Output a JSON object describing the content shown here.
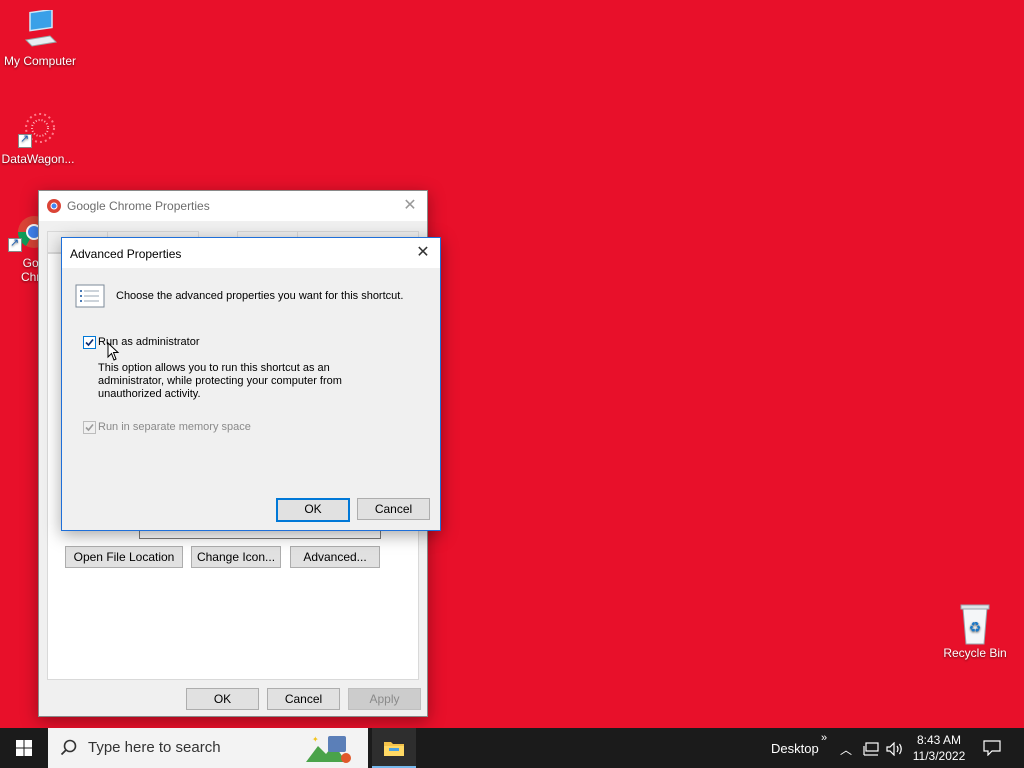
{
  "desktop": {
    "background_color": "#e8102a",
    "icons": [
      {
        "label": "My Computer",
        "icon": "computer-icon"
      },
      {
        "label": "DataWagon...",
        "icon": "datawagon-icon"
      },
      {
        "label": "Goo\nChro",
        "icon": "chrome-icon"
      },
      {
        "label": "Recycle Bin",
        "icon": "recycle-bin-icon"
      }
    ]
  },
  "properties_dialog": {
    "title": "Google Chrome Properties",
    "buttons": {
      "open_file_location": "Open File Location",
      "change_icon": "Change Icon...",
      "advanced": "Advanced...",
      "ok": "OK",
      "cancel": "Cancel",
      "apply": "Apply"
    }
  },
  "advanced_dialog": {
    "title": "Advanced Properties",
    "description": "Choose the advanced properties you want for this shortcut.",
    "run_as_admin": {
      "label": "Run as administrator",
      "checked": true
    },
    "help_text": "This option allows you to run this shortcut as an administrator, while protecting your computer from unauthorized activity.",
    "separate_memory": {
      "label": "Run in separate memory space",
      "checked": true,
      "enabled": false
    },
    "ok": "OK",
    "cancel": "Cancel"
  },
  "taskbar": {
    "search_placeholder": "Type here to search",
    "desktop_label": "Desktop",
    "overflow_label": "»",
    "time": "8:43 AM",
    "date": "11/3/2022"
  }
}
